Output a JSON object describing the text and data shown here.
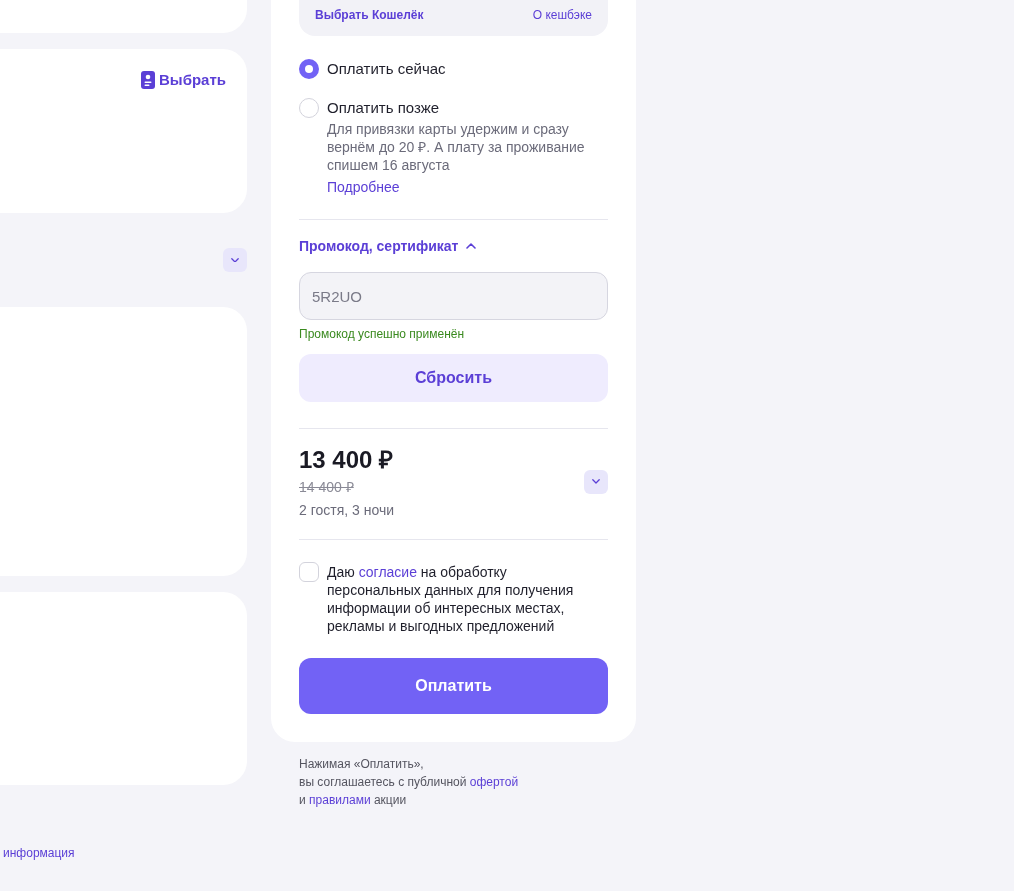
{
  "left_column": {
    "select_link": "Выбрать",
    "info_link": "информация"
  },
  "payment_panel": {
    "wallet": {
      "choose_link": "Выбрать Кошелёк",
      "cashback_link": "О кешбэке"
    },
    "payment_options": [
      {
        "label": "Оплатить сейчас",
        "selected": true
      },
      {
        "label": "Оплатить позже",
        "selected": false,
        "description": "Для привязки карты удержим и сразу вернём до 20 ₽. А плату за проживание спишем 16 августа",
        "more_link": "Подробнее"
      }
    ],
    "promo": {
      "title": "Промокод, сертификат",
      "expanded": true,
      "value": "5R2UO",
      "message": "Промокод успешно применён",
      "reset_button": "Сбросить"
    },
    "price": {
      "total": "13 400 ₽",
      "old_price": "14 400 ₽",
      "details": "2 гостя, 3 ночи",
      "expanded": false
    },
    "consent": {
      "checked": false,
      "segments": [
        {
          "kind": "text",
          "text": "Даю "
        },
        {
          "kind": "link",
          "text": "согласие"
        },
        {
          "kind": "text",
          "text": " на обработку персональных данных для получения информации об интересных местах, рекламы и выгодных предложений"
        }
      ]
    },
    "pay_button": "Оплатить"
  },
  "footer_note": {
    "lines": [
      [
        {
          "kind": "text",
          "text": "Нажимая «Оплатить»,"
        }
      ],
      [
        {
          "kind": "text",
          "text": "вы соглашаетесь с публичной "
        },
        {
          "kind": "link",
          "text": "офертой"
        }
      ],
      [
        {
          "kind": "text",
          "text": "и "
        },
        {
          "kind": "link",
          "text": "правилами"
        },
        {
          "kind": "text",
          "text": " акции"
        }
      ]
    ]
  }
}
